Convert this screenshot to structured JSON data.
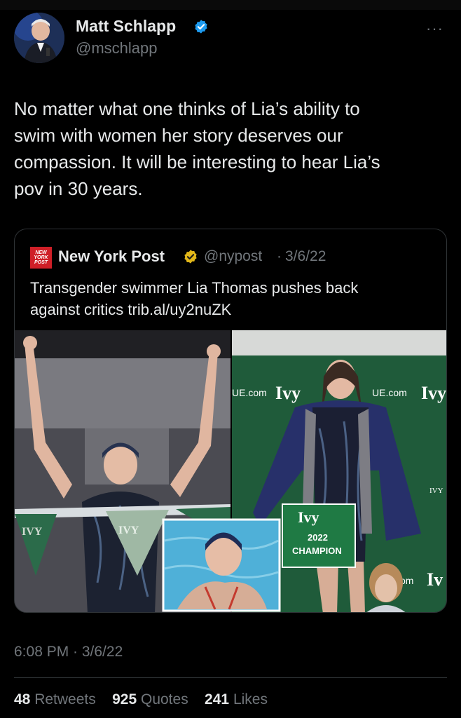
{
  "author": {
    "name": "Matt Schlapp",
    "handle": "@mschlapp"
  },
  "tweet": {
    "text_lines": [
      "No matter what one thinks of Lia’s ability to",
      "swim with women her story deserves our",
      "compassion. It will be interesting to hear Lia’s",
      "pov in 30 years."
    ],
    "more_label": "···",
    "timestamp": "6:08 PM · 3/6/22"
  },
  "quoted": {
    "logo_text": "NEW YORK POST",
    "name": "New York Post",
    "handle": "@nypost",
    "separator": "·",
    "date": "3/6/22",
    "text_lines": [
      "Transgender swimmer Lia Thomas pushes back",
      "against critics trib.al/uy2nuZK"
    ],
    "media": {
      "banner_left": "UE.com",
      "banner_ivy": "Ivy",
      "banner_right": "UE.com",
      "banner_ivy2": "Ivy",
      "banner_bottom": "om",
      "banner_ivy3": "Iv",
      "sign_ivy": "Ivy",
      "sign_year": "2022",
      "sign_title": "CHAMPION",
      "flag_text_1": "IVY",
      "flag_text_2": "IVY",
      "side_ivy": "IVY"
    }
  },
  "stats": {
    "retweets_count": "48",
    "retweets_label": "Retweets",
    "quotes_count": "925",
    "quotes_label": "Quotes",
    "likes_count": "241",
    "likes_label": "Likes"
  },
  "colors": {
    "background": "#000000",
    "text": "#e7e9ea",
    "secondary": "#71767b",
    "verified_blue": "#1d9bf0",
    "verified_gold": "#e2b719",
    "nypost_red": "#cf1f27",
    "banner_green": "#1f5b3a"
  },
  "icons": [
    "verified-badge-icon",
    "gold-verified-badge-icon",
    "more-icon"
  ]
}
